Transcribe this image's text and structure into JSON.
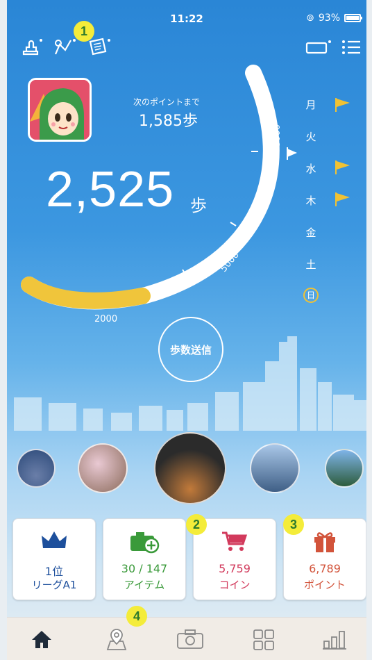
{
  "status": {
    "time": "11:22",
    "battery": "93%"
  },
  "header": {
    "next_label": "次のポイントまで",
    "next_value": "1,585歩"
  },
  "steps": {
    "value": "2,525",
    "unit": "歩"
  },
  "goal_ticks": {
    "t8000": "8000",
    "t5000": "5000",
    "t2000": "2000"
  },
  "progress": {
    "fraction": 0.3156
  },
  "weekdays": [
    {
      "label": "月",
      "flag": true
    },
    {
      "label": "火",
      "flag": false
    },
    {
      "label": "水",
      "flag": true
    },
    {
      "label": "木",
      "flag": true
    },
    {
      "label": "金",
      "flag": false
    },
    {
      "label": "土",
      "flag": false
    },
    {
      "label": "日",
      "flag": false,
      "today": true
    }
  ],
  "send_button": "歩数送信",
  "badges": {
    "b1": "1",
    "b2": "2",
    "b3": "3",
    "b4": "4"
  },
  "cards": [
    {
      "line1": "1位",
      "line2": "リーグA1",
      "color": "#1d4f9c",
      "icon": "crown-icon"
    },
    {
      "line1": "30 / 147",
      "line2": "アイテム",
      "color": "#3a9a3a",
      "icon": "camera-plus-icon"
    },
    {
      "line1": "5,759",
      "line2": "コイン",
      "color": "#d23a5c",
      "icon": "cart-icon"
    },
    {
      "line1": "6,789",
      "line2": "ポイント",
      "color": "#d2533a",
      "icon": "gift-icon"
    }
  ],
  "colors": {
    "progress": "#f0c53b",
    "track": "#ffffff",
    "flag": "#f1c233"
  },
  "tabs": [
    "home-icon",
    "map-pin-icon",
    "camera-icon",
    "grid-icon",
    "chart-icon"
  ]
}
